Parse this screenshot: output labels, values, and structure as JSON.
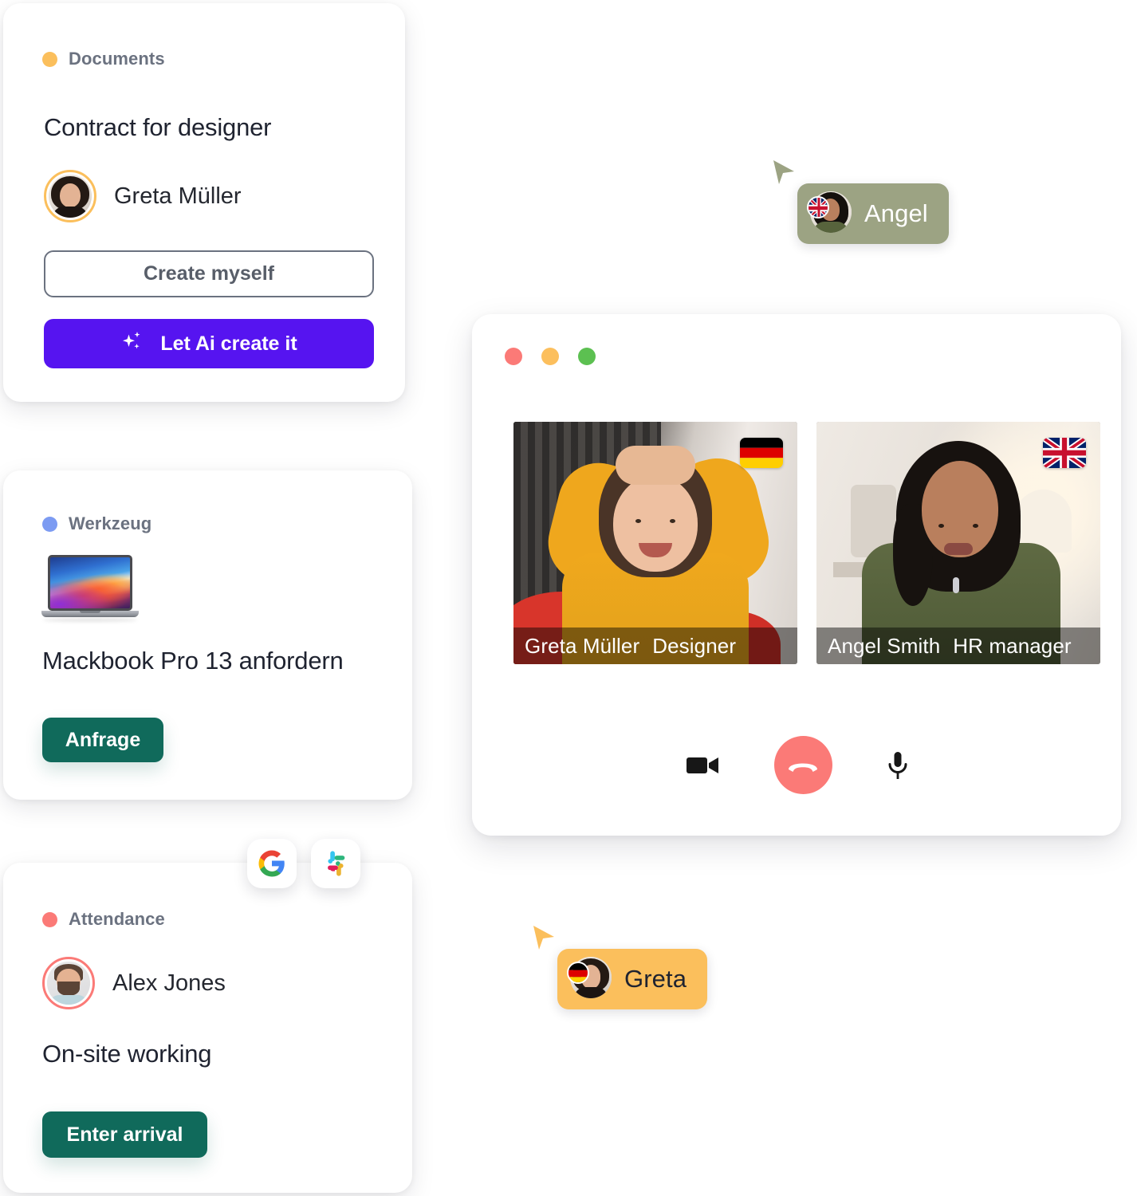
{
  "cards": {
    "documents": {
      "tag_label": "Documents",
      "tag_color": "#FBBF5C",
      "title": "Contract for designer",
      "person_name": "Greta Müller",
      "avatar_ring_color": "#FBBF5C",
      "secondary_button": "Create myself",
      "primary_button": "Let Ai create it",
      "primary_button_color": "#5614F0",
      "sparkle_icon": "sparkles-icon"
    },
    "tool": {
      "tag_label": "Werkzeug",
      "tag_color": "#7C9BF2",
      "title": "Mackbook Pro 13 anfordern",
      "product_icon": "macbook-pro-icon",
      "button": "Anfrage",
      "button_color": "#106A5B"
    },
    "attendance": {
      "tag_label": "Attendance",
      "tag_color": "#FB7A77",
      "person_name": "Alex Jones",
      "avatar_ring_color": "#FB7A77",
      "title": "On-site working",
      "button": "Enter arrival",
      "button_color": "#106A5B",
      "app_icons": [
        {
          "name": "google-icon",
          "label": "Google"
        },
        {
          "name": "slack-icon",
          "label": "Slack"
        }
      ]
    }
  },
  "video_call": {
    "traffic_lights": [
      {
        "name": "close-button",
        "color": "#FB7A77"
      },
      {
        "name": "minimize-button",
        "color": "#FCBF5D"
      },
      {
        "name": "maximize-button",
        "color": "#5CC051"
      }
    ],
    "participants": [
      {
        "name": "Greta Müller",
        "role": "Designer",
        "flag": "flag-de",
        "flag_label": "Germany"
      },
      {
        "name": "Angel Smith",
        "role": "HR manager",
        "flag": "flag-gb",
        "flag_label": "United Kingdom"
      }
    ],
    "controls": [
      {
        "name": "camera-icon",
        "label": "Camera"
      },
      {
        "name": "hangup-icon",
        "label": "End call",
        "color": "#FB7A77"
      },
      {
        "name": "microphone-icon",
        "label": "Microphone"
      }
    ]
  },
  "cursors": [
    {
      "name": "Angel",
      "color": "#9CA383",
      "text_color": "#FFFFFF",
      "flag": "flag-gb",
      "flag_label": "United Kingdom"
    },
    {
      "name": "Greta",
      "color": "#FBBF5C",
      "text_color": "#1F2330",
      "flag": "flag-de",
      "flag_label": "Germany"
    }
  ]
}
